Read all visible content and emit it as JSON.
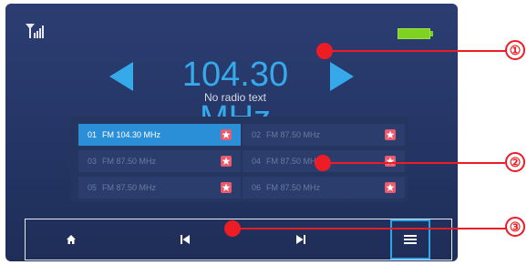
{
  "status": {
    "signal_icon": "signal-icon",
    "battery_icon": "battery-icon"
  },
  "tuner": {
    "frequency": "104.30 MHz",
    "radio_text": "No radio text",
    "accent_color": "#35a9e9"
  },
  "presets": [
    {
      "num": "01",
      "label": "FM 104.30 MHz",
      "active": true
    },
    {
      "num": "02",
      "label": "FM 87.50 MHz",
      "active": false
    },
    {
      "num": "03",
      "label": "FM 87.50 MHz",
      "active": false
    },
    {
      "num": "04",
      "label": "FM 87.50 MHz",
      "active": false
    },
    {
      "num": "05",
      "label": "FM 87.50 MHz",
      "active": false
    },
    {
      "num": "06",
      "label": "FM 87.50 MHz",
      "active": false
    }
  ],
  "toolbar": {
    "home_icon": "home-icon",
    "prev_icon": "previous-icon",
    "next_icon": "next-icon",
    "list_icon": "list-icon"
  },
  "callouts": [
    "①",
    "②",
    "③"
  ],
  "callout_color": "#ee1c24"
}
